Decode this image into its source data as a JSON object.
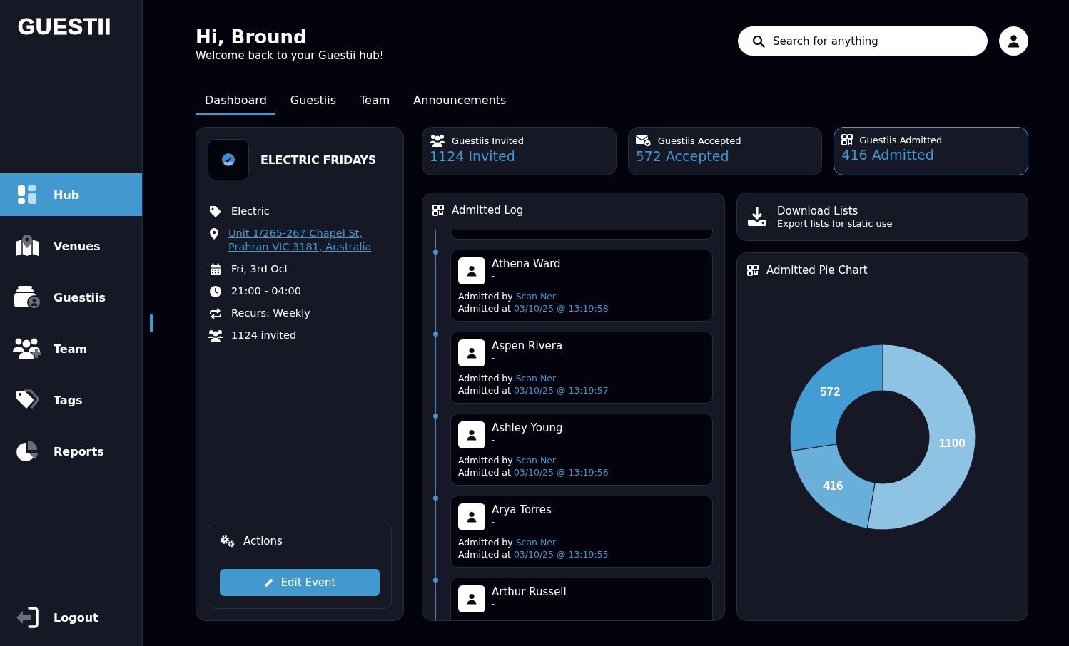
{
  "sidebar": {
    "logo": "GUESTII",
    "items": [
      {
        "label": "Hub",
        "selected": true
      },
      {
        "label": "Venues",
        "selected": false
      },
      {
        "label": "Guestiis",
        "selected": false
      },
      {
        "label": "Team",
        "selected": false
      },
      {
        "label": "Tags",
        "selected": false
      },
      {
        "label": "Reports",
        "selected": false
      }
    ],
    "logout": "Logout"
  },
  "header": {
    "greeting": "Hi, Bround",
    "subtitle": "Welcome back to your Guestii hub!",
    "search": {
      "placeholder": "Search for anything"
    }
  },
  "tabs": [
    {
      "label": "Dashboard",
      "selected": true
    },
    {
      "label": "Guestiis",
      "selected": false
    },
    {
      "label": "Team",
      "selected": false
    },
    {
      "label": "Announcements",
      "selected": false
    }
  ],
  "event": {
    "title": "ELECTRIC FRIDAYS",
    "details": [
      {
        "kind": "tag",
        "text": "Electric"
      },
      {
        "kind": "address",
        "text": "Unit 1/265-267 Chapel St, Prahran VIC 3181, Australia"
      },
      {
        "kind": "date",
        "text": "Fri, 3rd Oct"
      },
      {
        "kind": "time",
        "text": "21:00 - 04:00"
      },
      {
        "kind": "recur",
        "text": "Recurs: Weekly"
      },
      {
        "kind": "people",
        "text": "1124 invited"
      }
    ],
    "actions": {
      "title": "Actions",
      "button": "Edit Event"
    }
  },
  "stats": [
    {
      "kind": "people",
      "label": "Guestiis Invited",
      "value": "1124 Invited",
      "selected": false
    },
    {
      "kind": "mail",
      "label": "Guestiis Accepted",
      "value": "572 Accepted",
      "selected": false
    },
    {
      "kind": "qr",
      "label": "Guestiis Admitted",
      "value": "416 Admitted",
      "selected": true
    }
  ],
  "admitted_log": {
    "title": "Admitted Log",
    "entries": [
      {
        "name": "Athena Ward",
        "note": "-",
        "by_label": "Admitted by",
        "by": "Scan Ner",
        "at_label": "Admitted at",
        "at": "03/10/25 @ 13:19:58"
      },
      {
        "name": "Aspen Rivera",
        "note": "-",
        "by_label": "Admitted by",
        "by": "Scan Ner",
        "at_label": "Admitted at",
        "at": "03/10/25 @ 13:19:57"
      },
      {
        "name": "Ashley Young",
        "note": "-",
        "by_label": "Admitted by",
        "by": "Scan Ner",
        "at_label": "Admitted at",
        "at": "03/10/25 @ 13:19:56"
      },
      {
        "name": "Arya Torres",
        "note": "-",
        "by_label": "Admitted by",
        "by": "Scan Ner",
        "at_label": "Admitted at",
        "at": "03/10/25 @ 13:19:55"
      },
      {
        "name": "Arthur Russell",
        "note": "-"
      }
    ]
  },
  "download": {
    "title": "Download Lists",
    "subtitle": "Export lists for static use"
  },
  "pie": {
    "chart_data": {
      "type": "donut",
      "title": "Admitted Pie Chart",
      "values": [
        1100,
        416,
        572
      ],
      "data_labels": true
    }
  }
}
